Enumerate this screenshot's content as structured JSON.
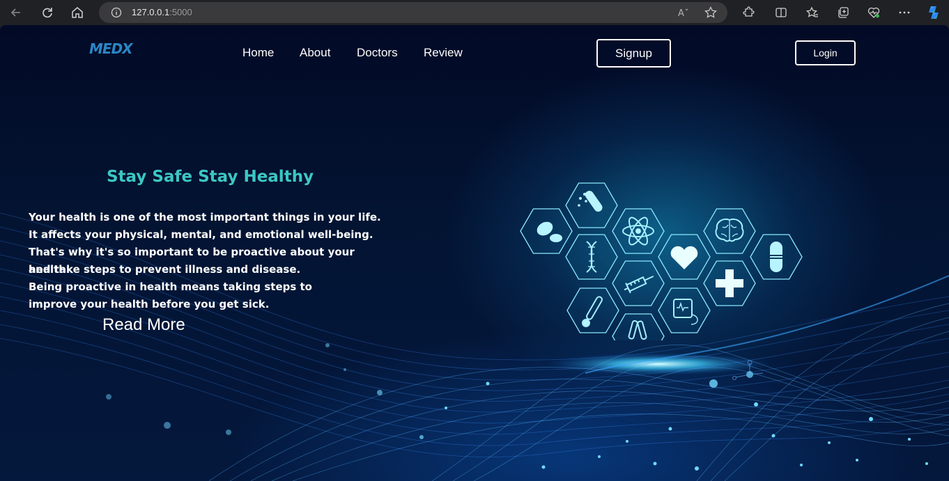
{
  "browser": {
    "url_host": "127.0.0.1",
    "url_port": ":5000",
    "icons": [
      "back-icon",
      "refresh-icon",
      "home-icon",
      "info-icon",
      "read-aloud-icon",
      "favorite-star-icon",
      "extensions-icon",
      "split-screen-icon",
      "favorites-icon",
      "collections-icon",
      "health-icon",
      "more-icon",
      "copilot-icon"
    ]
  },
  "header": {
    "logo": "MEDX",
    "nav": [
      "Home",
      "About",
      "Doctors",
      "Review"
    ],
    "signup_label": "Signup",
    "login_label": "Login"
  },
  "hero": {
    "headline": "Stay Safe Stay Healthy",
    "lines": [
      "Your health is one of the most important things in your life.",
      "It affects your physical, mental, and emotional well-being.",
      "That's why it's so important to be proactive about your health",
      "and take steps to prevent illness and disease.",
      "Being proactive in health means taking steps to",
      "improve your health before you get sick."
    ],
    "read_more": "Read More"
  },
  "colors": {
    "accent": "#3cc7c4",
    "logo": "#2a86c6",
    "icon_glow": "#7be3ff"
  }
}
